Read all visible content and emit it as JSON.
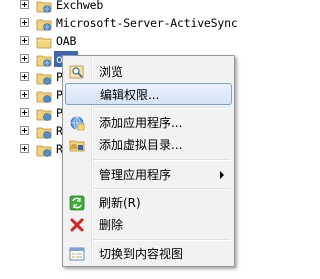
{
  "tree": {
    "nodes": [
      {
        "label": "Exchweb",
        "icon": "web-folder-icon"
      },
      {
        "label": "Microsoft-Server-ActiveSync",
        "icon": "web-folder-icon"
      },
      {
        "label": "OAB",
        "icon": "folder-icon"
      },
      {
        "label": "owa",
        "icon": "web-folder-icon",
        "selected": true
      },
      {
        "label": "Po",
        "icon": "web-folder-icon"
      },
      {
        "label": "Po",
        "icon": "web-folder-icon"
      },
      {
        "label": "Pu",
        "icon": "web-folder-icon"
      },
      {
        "label": "Rp",
        "icon": "web-folder-icon"
      },
      {
        "label": "Rp",
        "icon": "web-folder-icon"
      }
    ]
  },
  "context_menu": {
    "items": [
      {
        "label": "浏览",
        "icon": "browse-icon"
      },
      {
        "label": "编辑权限...",
        "icon": "",
        "highlighted": true
      },
      {
        "label": "添加应用程序...",
        "icon": "add-application-icon"
      },
      {
        "label": "添加虚拟目录...",
        "icon": "add-virtual-directory-icon"
      },
      {
        "label": "管理应用程序",
        "icon": "",
        "submenu": true
      },
      {
        "label": "刷新(R)",
        "icon": "refresh-icon"
      },
      {
        "label": "删除",
        "icon": "delete-icon"
      },
      {
        "label": "切换到内容视图",
        "icon": "content-view-icon"
      }
    ]
  },
  "colors": {
    "selection": "#3a66b7",
    "menu_background": "#f2f2f2",
    "menu_highlight_border": "#7da2ce"
  }
}
